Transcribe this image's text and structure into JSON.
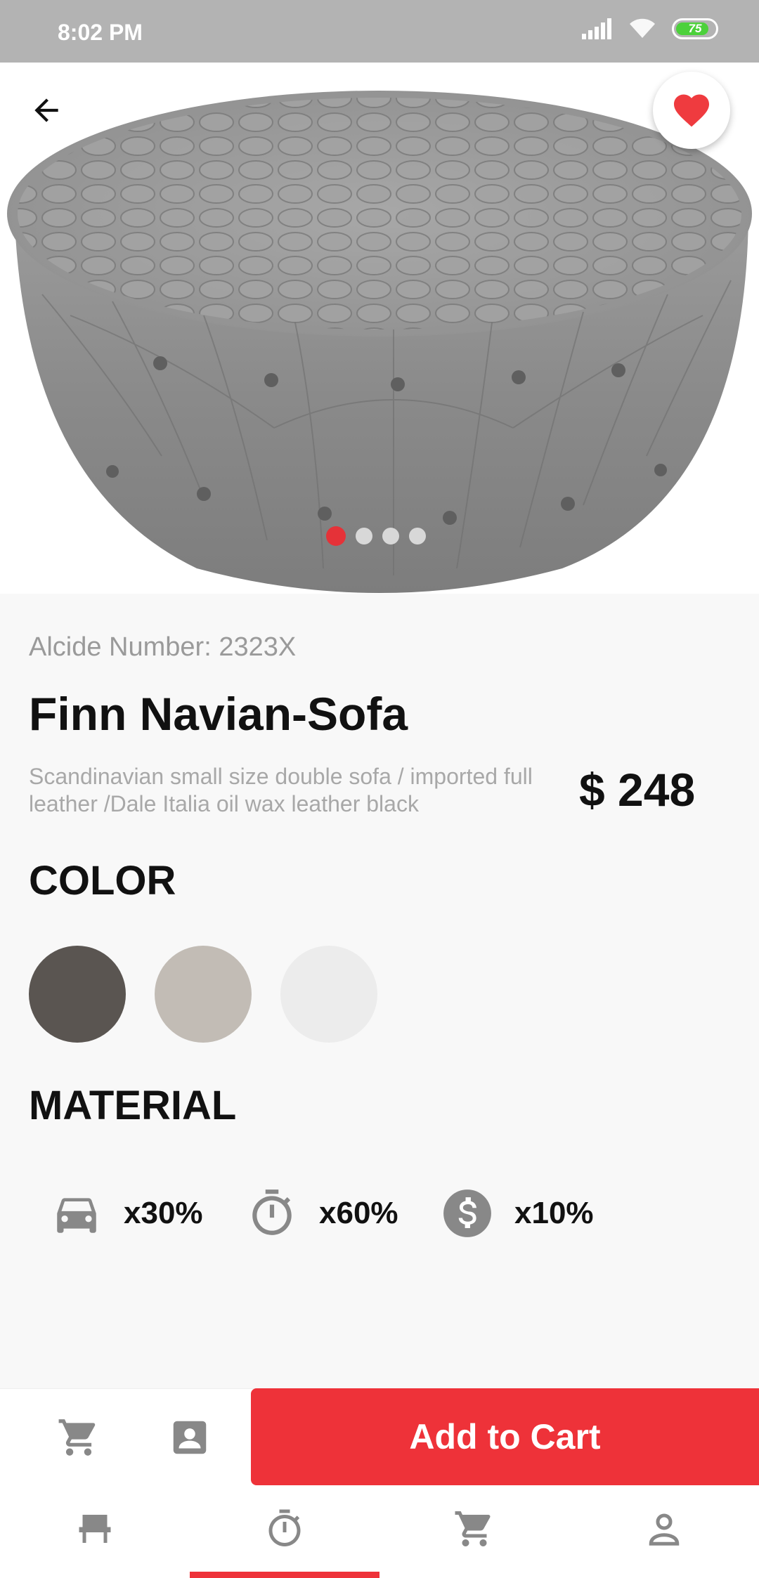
{
  "status_bar": {
    "time": "8:02 PM",
    "battery": "75"
  },
  "product": {
    "article": "Alcide Number: 2323X",
    "title": "Finn Navian-Sofa",
    "description": "Scandinavian small size double sofa / imported full leather /Dale Italia oil wax leather black",
    "price": "$ 248",
    "image_count": 4,
    "active_image": 1
  },
  "color_section": {
    "title": "COLOR",
    "swatches": [
      "#5a5551",
      "#c2bcb5",
      "#ececec"
    ]
  },
  "material_section": {
    "title": "MATERIAL",
    "items": [
      {
        "icon": "car-icon",
        "label": "x30%"
      },
      {
        "icon": "timer-icon",
        "label": "x60%"
      },
      {
        "icon": "dollar-icon",
        "label": "x10%"
      }
    ]
  },
  "actions": {
    "add_to_cart": "Add to Cart"
  },
  "bottom_nav": {
    "items": [
      "chair-icon",
      "timer-icon",
      "cart-icon",
      "person-icon"
    ],
    "active_index": 1
  },
  "colors": {
    "accent": "#ee3239",
    "heart": "#ef3b3f"
  }
}
